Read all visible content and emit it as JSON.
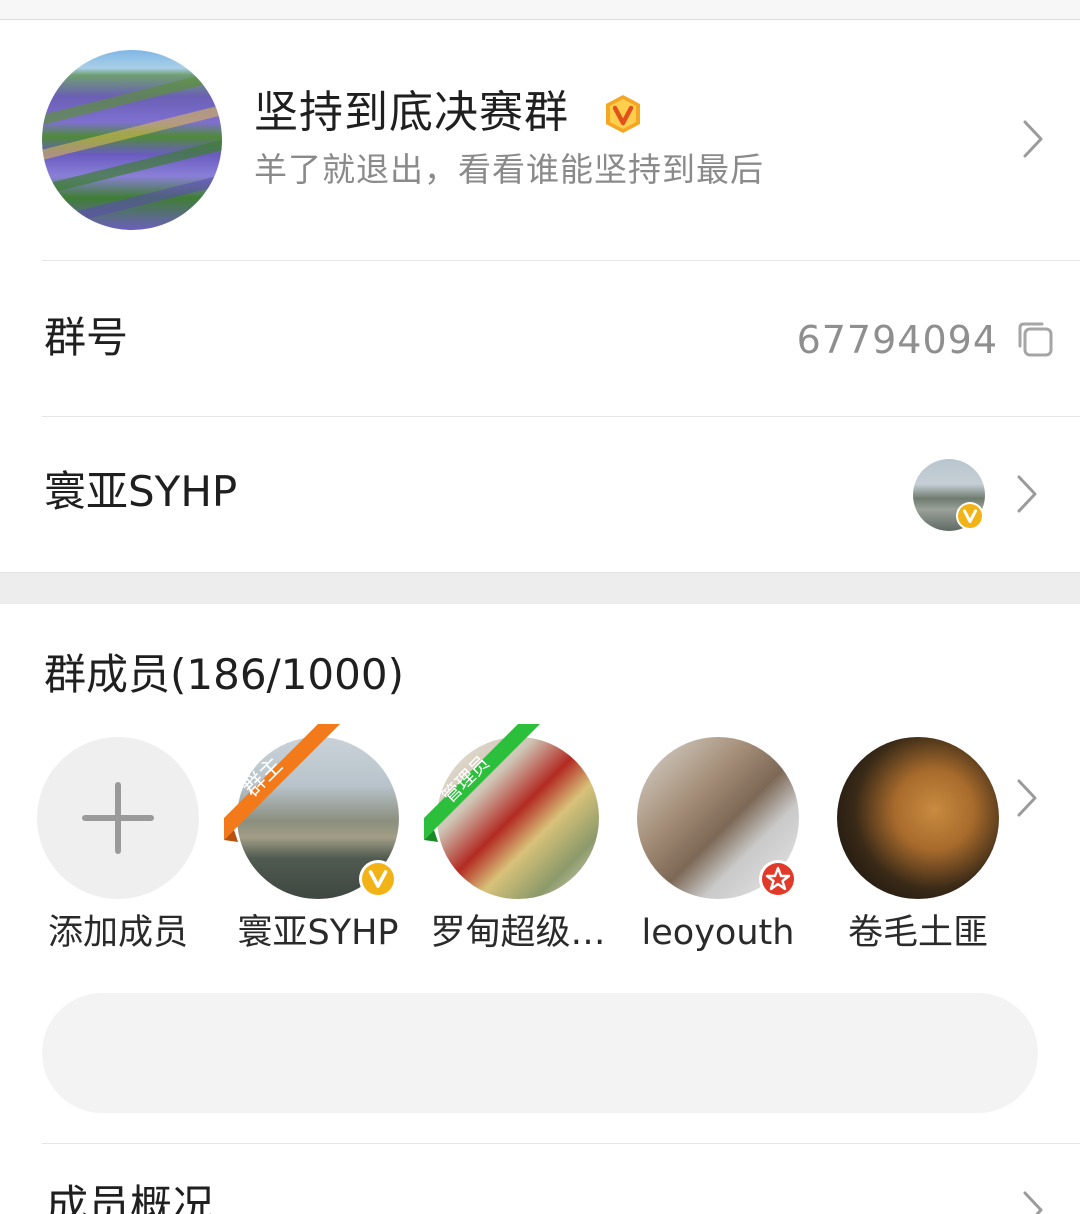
{
  "header": {
    "group_name": "坚持到底决赛群",
    "group_desc": "羊了就退出，看看谁能坚持到最后",
    "vip_badge_letter": "V"
  },
  "group_number_row": {
    "label": "群号",
    "value": "67794094",
    "copy_icon": "copy-icon"
  },
  "owner_row": {
    "label": "寰亚SYHP",
    "badge_letter": "V"
  },
  "members": {
    "title": "群成员(186/1000)",
    "items": [
      {
        "name": "添加成员",
        "role": ""
      },
      {
        "name": "寰亚SYHP",
        "role": "群主",
        "badge": "V"
      },
      {
        "name": "罗甸超级…",
        "role": "管理员"
      },
      {
        "name": "leoyouth",
        "role": "",
        "badge": "star"
      },
      {
        "name": "卷毛土匪",
        "role": ""
      }
    ],
    "owner_ribbon_color": "#f27a1a",
    "admin_ribbon_color": "#2cbf3c"
  },
  "search": {
    "placeholder": ""
  },
  "overview": {
    "label": "成员概况"
  },
  "colors": {
    "vip_gold": "#f5a623",
    "divider": "#e6e6e6",
    "secondary_text": "#8a8a8a"
  }
}
